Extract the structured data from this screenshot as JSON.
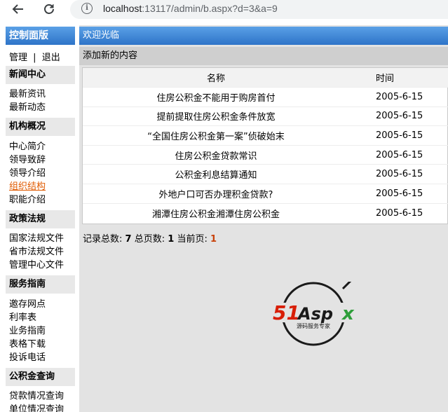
{
  "browser": {
    "url_host": "localhost",
    "url_rest": ":13117/admin/b.aspx?d=3&a=9"
  },
  "sidebar": {
    "title": "控制面版",
    "top_links": {
      "manage": "管理",
      "sep": "|",
      "logout": "退出"
    },
    "sections": [
      {
        "title": "新闻中心",
        "items": [
          "最新资讯",
          "最新动态"
        ]
      },
      {
        "title": "机构概况",
        "items": [
          "中心简介",
          "领导致辞",
          "领导介绍",
          "组织结构",
          "职能介绍"
        ]
      },
      {
        "title": "政策法规",
        "items": [
          "国家法规文件",
          "省市法规文件",
          "管理中心文件"
        ]
      },
      {
        "title": "服务指南",
        "items": [
          "邀存网点",
          "利率表",
          "业务指南",
          "表格下载",
          "投诉电话"
        ]
      },
      {
        "title": "公积金查询",
        "items": [
          "贷款情况查询",
          "单位情况查询"
        ]
      }
    ],
    "active_item": "组织结构"
  },
  "main": {
    "welcome": "欢迎光临",
    "add_content": "添加新的内容",
    "table": {
      "headers": {
        "name": "名称",
        "time": "时间"
      },
      "rows": [
        {
          "name": "住房公积金不能用于购房首付",
          "time": "2005-6-15"
        },
        {
          "name": "提前提取住房公积金条件放宽",
          "time": "2005-6-15"
        },
        {
          "name": "“全国住房公积金第一案”侦破始末",
          "time": "2005-6-15"
        },
        {
          "name": "住房公积金贷款常识",
          "time": "2005-6-15"
        },
        {
          "name": "公积金利息结算通知",
          "time": "2005-6-15"
        },
        {
          "name": "外地户口可否办理积金贷款?",
          "time": "2005-6-15"
        },
        {
          "name": "湘潭住房公积金湘潭住房公积金",
          "time": "2005-6-15"
        }
      ]
    },
    "pager": {
      "total_label": "记录总数:",
      "total": "7",
      "pages_label": "总页数:",
      "pages": "1",
      "current_label": "当前页:",
      "current": "1"
    }
  },
  "logo": {
    "brand": "51Aspx",
    "tagline": "源码服务专家"
  },
  "colors": {
    "header_blue": "#2e74c8",
    "active_link": "#e05a00",
    "logo_red": "#d81e06",
    "logo_green": "#2e9e3a"
  }
}
